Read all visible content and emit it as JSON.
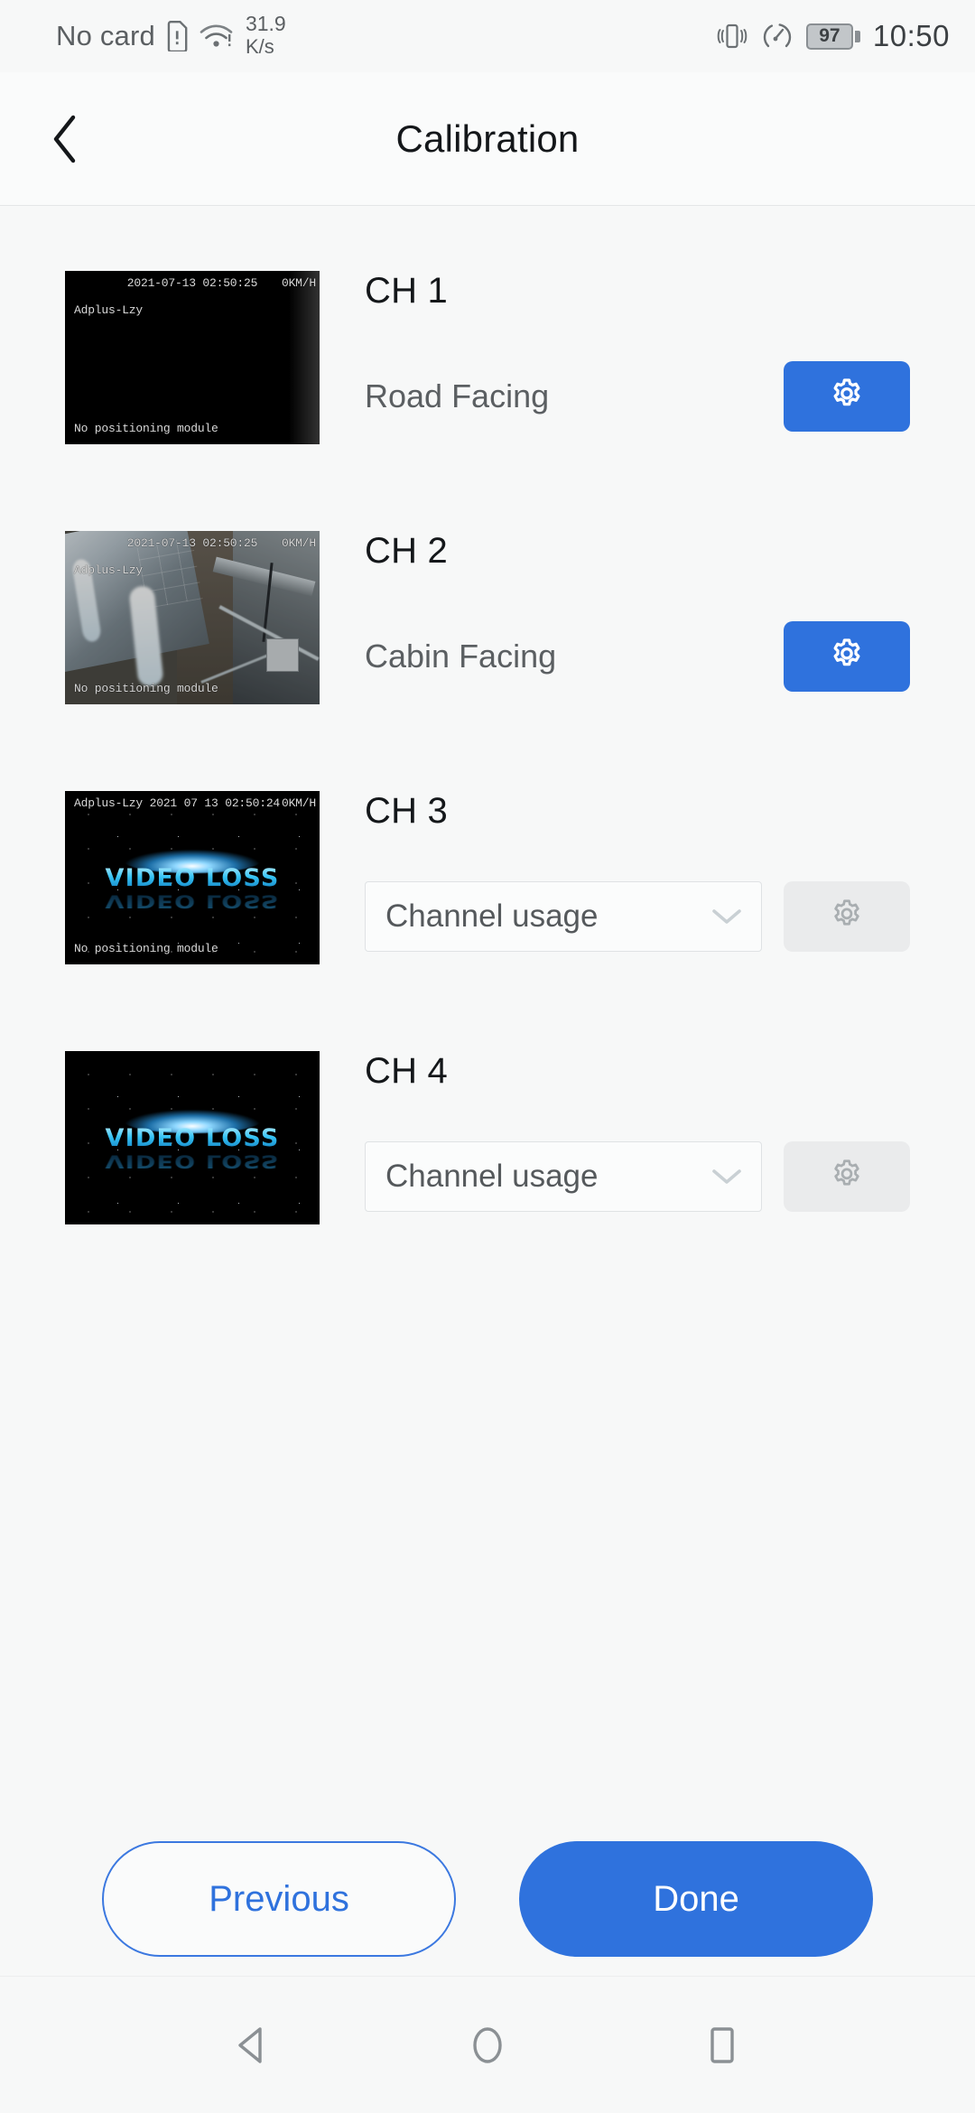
{
  "status_bar": {
    "carrier": "No card",
    "sim_icon": "sim-card-alert-icon",
    "wifi_icon": "wifi-alert-icon",
    "net_speed_value": "31.9",
    "net_speed_unit": "K/s",
    "vibrate_icon": "vibrate-icon",
    "data_saver_icon": "speedometer-icon",
    "battery_icon": "battery-icon",
    "battery_level": "97",
    "time": "10:50"
  },
  "app_bar": {
    "back_icon": "chevron-left-icon",
    "title": "Calibration"
  },
  "channels": [
    {
      "title": "CH 1",
      "usage_label": "Road Facing",
      "control": "label",
      "gear_enabled": true,
      "gear_icon": "gear-icon",
      "preview_kind": "dark",
      "overlay": {
        "datetime": "2021-07-13 02:50:25",
        "device": "Adplus-Lzy",
        "speed": "0KM/H",
        "gps": "No positioning module"
      }
    },
    {
      "title": "CH 2",
      "usage_label": "Cabin Facing",
      "control": "label",
      "gear_enabled": true,
      "gear_icon": "gear-icon",
      "preview_kind": "cabin",
      "overlay": {
        "datetime": "2021-07-13 02:50:25",
        "device": "Adplus-Lzy",
        "speed": "0KM/H",
        "gps": "No positioning module"
      }
    },
    {
      "title": "CH 3",
      "usage_label": "Channel usage",
      "control": "select",
      "gear_enabled": false,
      "gear_icon": "gear-icon",
      "dropdown_icon": "chevron-down-icon",
      "preview_kind": "video-loss",
      "preview_text": "VIDEO LOSS",
      "overlay": {
        "top_line": "Adplus-Lzy 2021 07 13 02:50:24",
        "speed": "0KM/H",
        "gps": "No positioning module"
      }
    },
    {
      "title": "CH 4",
      "usage_label": "Channel usage",
      "control": "select",
      "gear_enabled": false,
      "gear_icon": "gear-icon",
      "dropdown_icon": "chevron-down-icon",
      "preview_kind": "video-loss",
      "preview_text": "VIDEO LOSS",
      "overlay": {}
    }
  ],
  "footer": {
    "previous_label": "Previous",
    "done_label": "Done"
  },
  "nav_bar": {
    "back_icon": "triangle-back-icon",
    "home_icon": "circle-home-icon",
    "recents_icon": "square-recents-icon"
  },
  "colors": {
    "accent": "#2f72dd",
    "page_bg": "#f7f8f8",
    "title_text": "#14171a",
    "secondary_text": "#5b5f62",
    "disabled_bg": "#eaebec"
  }
}
